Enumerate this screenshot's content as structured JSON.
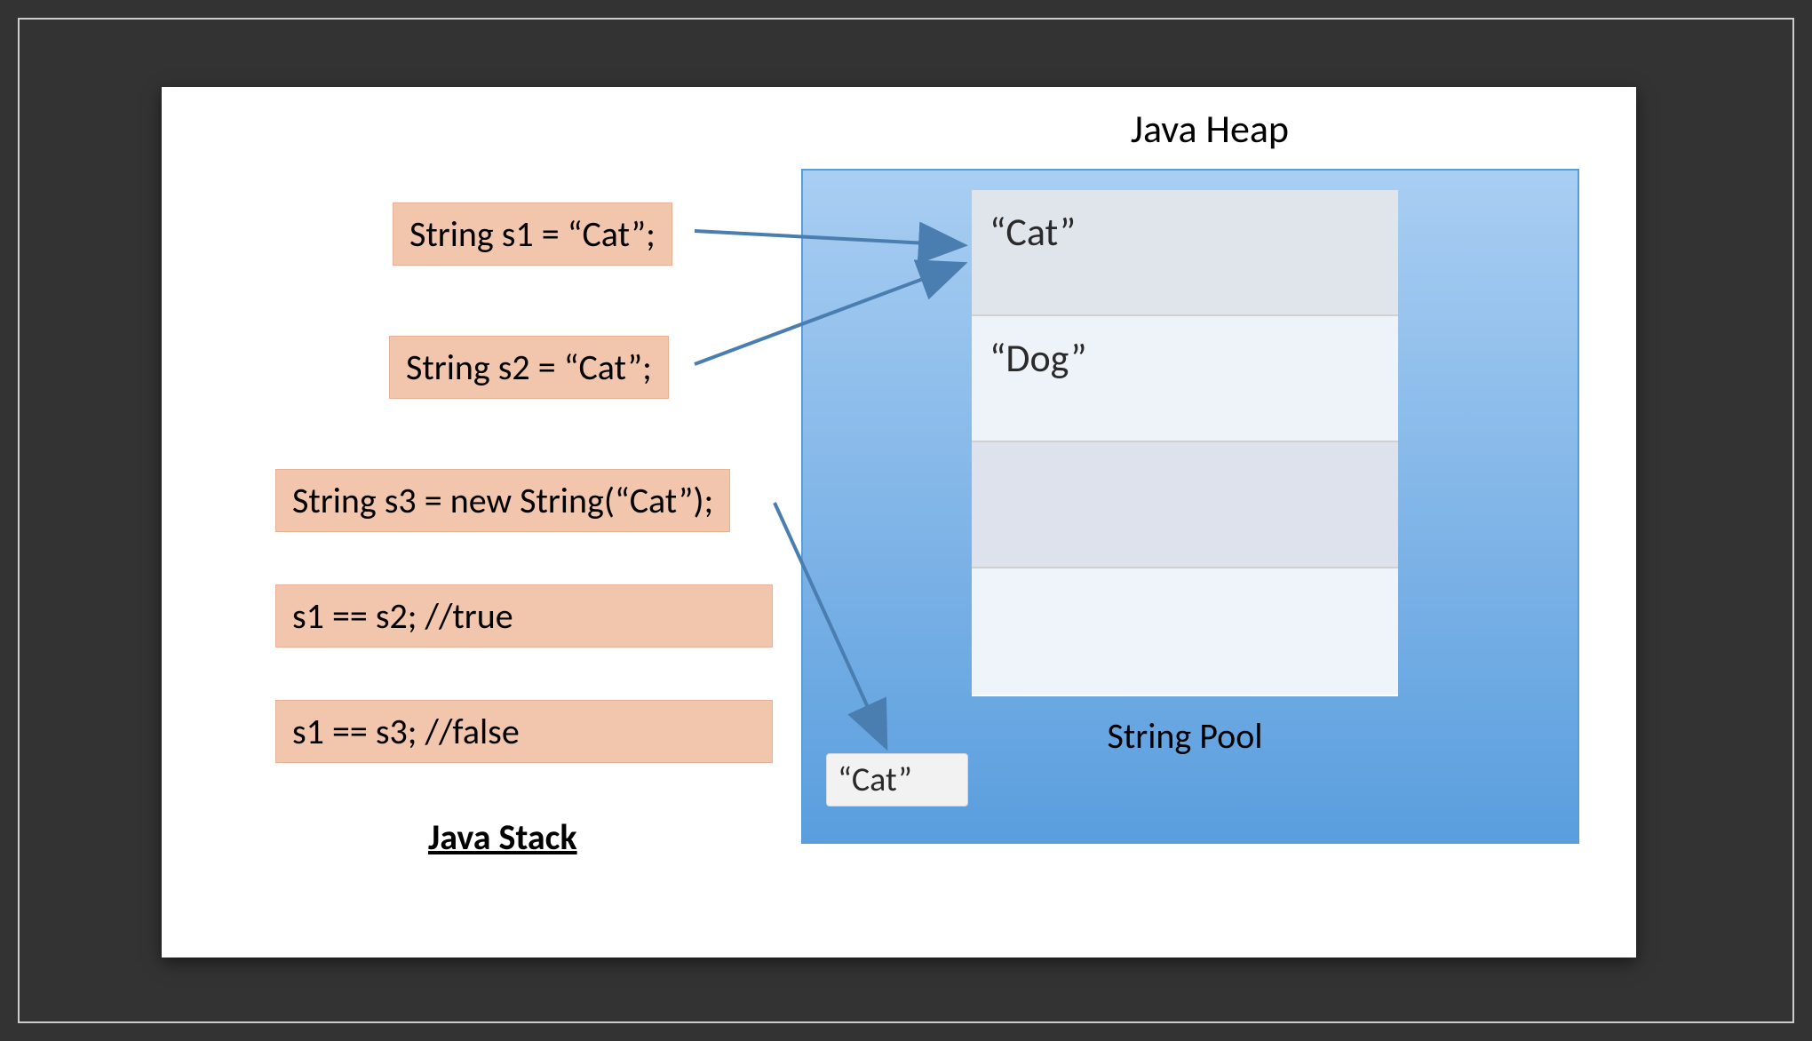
{
  "heap_title": "Java Heap",
  "stack_label": "Java Stack",
  "pool_label": "String Pool",
  "code": {
    "s1": "String s1 = “Cat”;",
    "s2": "String s2 = “Cat”;",
    "s3": "String s3 = new String(“Cat”);",
    "cmp1": "s1 == s2; //true",
    "cmp2": "s1 == s3; //false"
  },
  "pool": {
    "row0": "“Cat”",
    "row1": "“Dog”",
    "row2": "",
    "row3": ""
  },
  "heap_object": "“Cat”",
  "colors": {
    "code_bg": "#f2c5ad",
    "heap_top": "#a9cef2",
    "heap_bottom": "#5a9ede",
    "arrow": "#4a7db0"
  }
}
